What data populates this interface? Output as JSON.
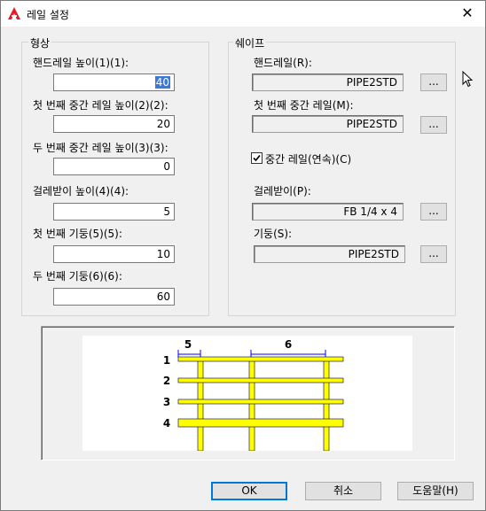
{
  "window": {
    "title": "레일 설정",
    "close_glyph": "✕",
    "app_icon": "autocad-logo-icon"
  },
  "shape_group": {
    "label": "형상",
    "fields": [
      {
        "label": "핸드레일 높이(1)(1):",
        "value": "40",
        "selected": true
      },
      {
        "label": "첫 번째 중간 레일 높이(2)(2):",
        "value": "20"
      },
      {
        "label": "두 번째 중간 레일 높이(3)(3):",
        "value": "0"
      },
      {
        "label": "걸레받이 높이(4)(4):",
        "value": "5"
      },
      {
        "label": "첫 번째 기둥(5)(5):",
        "value": "10"
      },
      {
        "label": "두 번째 기둥(6)(6):",
        "value": "60"
      }
    ]
  },
  "profile_group": {
    "label": "쉐이프",
    "handrail_label": "핸드레일(R):",
    "handrail_value": "PIPE2STD",
    "midrail_label": "첫 번째 중간 레일(M):",
    "midrail_value": "PIPE2STD",
    "continuous_label": "중간 레일(연속)(C)",
    "continuous_checked": true,
    "toeplate_label": "걸레받이(P):",
    "toeplate_value": "FB 1/4 x 4",
    "post_label": "기둥(S):",
    "post_value": "PIPE2STD",
    "browse_label": "..."
  },
  "preview": {
    "dim_labels": [
      "5",
      "6"
    ],
    "rail_numbers": [
      "1",
      "2",
      "3",
      "4"
    ],
    "rail_color": "#ffff00"
  },
  "buttons": {
    "ok": "OK",
    "cancel": "취소",
    "help": "도움말(H)"
  }
}
